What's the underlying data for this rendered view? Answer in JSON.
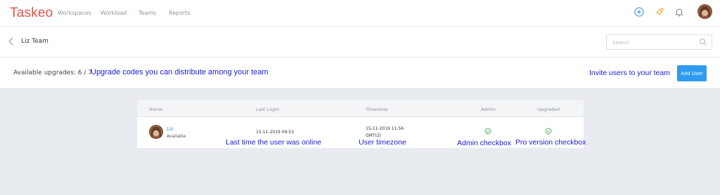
{
  "app": {
    "name": "Taskeo"
  },
  "nav": {
    "items": [
      "Workspaces",
      "Workload",
      "Teams",
      "Reports"
    ]
  },
  "header": {
    "title": "Liz Team"
  },
  "search": {
    "placeholder": "Search"
  },
  "upgrades": {
    "label": "Available upgrades: 6 / 7",
    "annotation": "Upgrade codes you can distribute among your team",
    "invite_annotation": "Invite users to your team",
    "add_user_label": "Add User"
  },
  "table": {
    "columns": [
      "Name",
      "Last Login",
      "Timezone",
      "Admin",
      "Upgraded"
    ],
    "rows": [
      {
        "name": "Liz",
        "status": "Available",
        "last_login": "15-11-2019 09:53",
        "timezone_line1": "15-11-2019 11:56",
        "timezone_line2": "GMT(2)",
        "admin": true,
        "upgraded": true
      }
    ]
  },
  "annotations": {
    "last_login": "Last time the user was online",
    "timezone": "User timezone",
    "admin": "Admin checkbox",
    "upgraded": "Pro version checkbox"
  },
  "colors": {
    "brand": "#e8534a",
    "accent": "#2f9bf0",
    "check": "#4caf50",
    "annotation": "#1a1ad8"
  }
}
